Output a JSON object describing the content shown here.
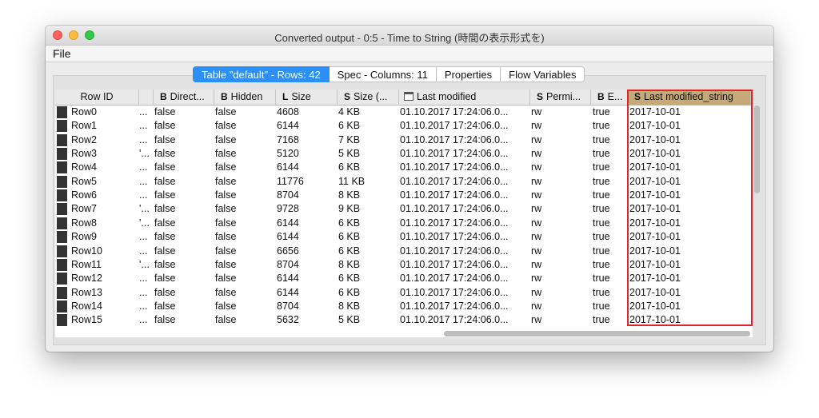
{
  "window": {
    "title": "Converted output - 0:5 - Time to String (時間の表示形式を)"
  },
  "menu": {
    "file": "File"
  },
  "tabs": [
    {
      "label": "Table \"default\" - Rows: 42",
      "active": true
    },
    {
      "label": "Spec - Columns: 11",
      "active": false
    },
    {
      "label": "Properties",
      "active": false
    },
    {
      "label": "Flow Variables",
      "active": false
    }
  ],
  "columns": {
    "rowid": {
      "label": "Row ID"
    },
    "c1": {
      "label": ""
    },
    "dir": {
      "badge": "B",
      "label": "Direct..."
    },
    "hidden": {
      "badge": "B",
      "label": "Hidden"
    },
    "size": {
      "badge": "L",
      "label": "Size"
    },
    "sizes": {
      "badge": "S",
      "label": "Size (..."
    },
    "lastmod": {
      "label": "Last modified"
    },
    "perm": {
      "badge": "S",
      "label": "Permi..."
    },
    "e": {
      "badge": "B",
      "label": "E..."
    },
    "lms": {
      "badge": "S",
      "label": "Last modified_string"
    }
  },
  "rows": [
    {
      "id": "Row0",
      "c1": "...",
      "dir": "false",
      "hidden": "false",
      "size": "4608",
      "sizes": "4 KB",
      "lastmod": "01.10.2017 17:24:06.0...",
      "perm": "rw",
      "e": "true",
      "lms": "2017-10-01"
    },
    {
      "id": "Row1",
      "c1": "...",
      "dir": "false",
      "hidden": "false",
      "size": "6144",
      "sizes": "6 KB",
      "lastmod": "01.10.2017 17:24:06.0...",
      "perm": "rw",
      "e": "true",
      "lms": "2017-10-01"
    },
    {
      "id": "Row2",
      "c1": "...",
      "dir": "false",
      "hidden": "false",
      "size": "7168",
      "sizes": "7 KB",
      "lastmod": "01.10.2017 17:24:06.0...",
      "perm": "rw",
      "e": "true",
      "lms": "2017-10-01"
    },
    {
      "id": "Row3",
      "c1": "'...",
      "dir": "false",
      "hidden": "false",
      "size": "5120",
      "sizes": "5 KB",
      "lastmod": "01.10.2017 17:24:06.0...",
      "perm": "rw",
      "e": "true",
      "lms": "2017-10-01"
    },
    {
      "id": "Row4",
      "c1": "...",
      "dir": "false",
      "hidden": "false",
      "size": "6144",
      "sizes": "6 KB",
      "lastmod": "01.10.2017 17:24:06.0...",
      "perm": "rw",
      "e": "true",
      "lms": "2017-10-01"
    },
    {
      "id": "Row5",
      "c1": "...",
      "dir": "false",
      "hidden": "false",
      "size": "11776",
      "sizes": "11 KB",
      "lastmod": "01.10.2017 17:24:06.0...",
      "perm": "rw",
      "e": "true",
      "lms": "2017-10-01"
    },
    {
      "id": "Row6",
      "c1": "...",
      "dir": "false",
      "hidden": "false",
      "size": "8704",
      "sizes": "8 KB",
      "lastmod": "01.10.2017 17:24:06.0...",
      "perm": "rw",
      "e": "true",
      "lms": "2017-10-01"
    },
    {
      "id": "Row7",
      "c1": "'...",
      "dir": "false",
      "hidden": "false",
      "size": "9728",
      "sizes": "9 KB",
      "lastmod": "01.10.2017 17:24:06.0...",
      "perm": "rw",
      "e": "true",
      "lms": "2017-10-01"
    },
    {
      "id": "Row8",
      "c1": "'...",
      "dir": "false",
      "hidden": "false",
      "size": "6144",
      "sizes": "6 KB",
      "lastmod": "01.10.2017 17:24:06.0...",
      "perm": "rw",
      "e": "true",
      "lms": "2017-10-01"
    },
    {
      "id": "Row9",
      "c1": "...",
      "dir": "false",
      "hidden": "false",
      "size": "6144",
      "sizes": "6 KB",
      "lastmod": "01.10.2017 17:24:06.0...",
      "perm": "rw",
      "e": "true",
      "lms": "2017-10-01"
    },
    {
      "id": "Row10",
      "c1": "...",
      "dir": "false",
      "hidden": "false",
      "size": "6656",
      "sizes": "6 KB",
      "lastmod": "01.10.2017 17:24:06.0...",
      "perm": "rw",
      "e": "true",
      "lms": "2017-10-01"
    },
    {
      "id": "Row11",
      "c1": "'...",
      "dir": "false",
      "hidden": "false",
      "size": "8704",
      "sizes": "8 KB",
      "lastmod": "01.10.2017 17:24:06.0...",
      "perm": "rw",
      "e": "true",
      "lms": "2017-10-01"
    },
    {
      "id": "Row12",
      "c1": "...",
      "dir": "false",
      "hidden": "false",
      "size": "6144",
      "sizes": "6 KB",
      "lastmod": "01.10.2017 17:24:06.0...",
      "perm": "rw",
      "e": "true",
      "lms": "2017-10-01"
    },
    {
      "id": "Row13",
      "c1": "...",
      "dir": "false",
      "hidden": "false",
      "size": "6144",
      "sizes": "6 KB",
      "lastmod": "01.10.2017 17:24:06.0...",
      "perm": "rw",
      "e": "true",
      "lms": "2017-10-01"
    },
    {
      "id": "Row14",
      "c1": "...",
      "dir": "false",
      "hidden": "false",
      "size": "8704",
      "sizes": "8 KB",
      "lastmod": "01.10.2017 17:24:06.0...",
      "perm": "rw",
      "e": "true",
      "lms": "2017-10-01"
    },
    {
      "id": "Row15",
      "c1": "...",
      "dir": "false",
      "hidden": "false",
      "size": "5632",
      "sizes": "5 KB",
      "lastmod": "01.10.2017 17:24:06.0...",
      "perm": "rw",
      "e": "true",
      "lms": "2017-10-01"
    }
  ]
}
